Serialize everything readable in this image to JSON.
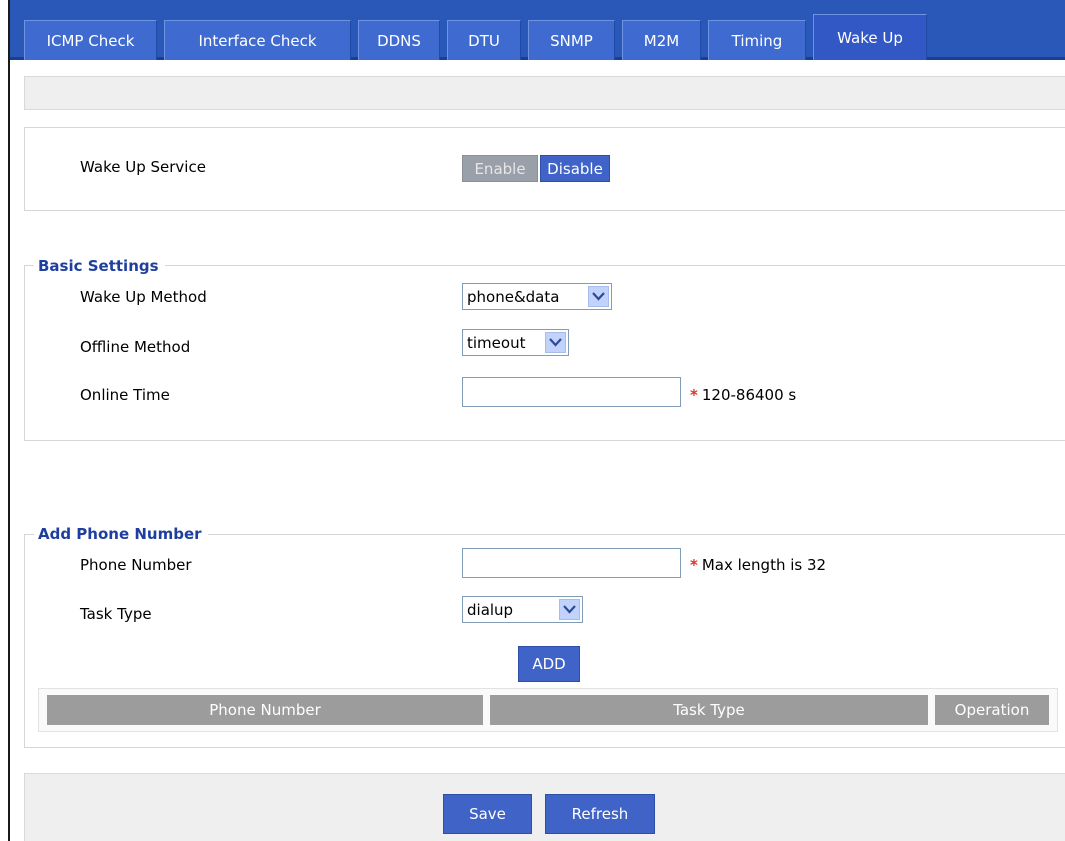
{
  "tabs": [
    {
      "label": "ICMP Check",
      "active": false
    },
    {
      "label": "Interface Check",
      "active": false
    },
    {
      "label": "DDNS",
      "active": false
    },
    {
      "label": "DTU",
      "active": false
    },
    {
      "label": "SNMP",
      "active": false
    },
    {
      "label": "M2M",
      "active": false
    },
    {
      "label": "Timing",
      "active": false
    },
    {
      "label": "Wake Up",
      "active": true
    }
  ],
  "service": {
    "label": "Wake Up Service",
    "enable_label": "Enable",
    "disable_label": "Disable",
    "selected": "Disable"
  },
  "basic": {
    "legend": "Basic Settings",
    "method_label": "Wake Up Method",
    "method_value": "phone&data",
    "offline_label": "Offline Method",
    "offline_value": "timeout",
    "online_label": "Online Time",
    "online_value": "",
    "online_hint": "120-86400 s",
    "required_mark": "*"
  },
  "phone": {
    "legend": "Add Phone Number",
    "number_label": "Phone Number",
    "number_value": "",
    "number_hint": "Max length is 32",
    "required_mark": "*",
    "task_label": "Task Type",
    "task_value": "dialup",
    "add_label": "ADD"
  },
  "table": {
    "columns": [
      "Phone Number",
      "Task Type",
      "Operation"
    ],
    "rows": []
  },
  "footer": {
    "save_label": "Save",
    "refresh_label": "Refresh"
  },
  "colors": {
    "tabbar": "#2a58b8",
    "tab": "#3f6ad0",
    "button": "#3f63c6",
    "required": "#e0302a",
    "legend": "#1f3f9e",
    "table_header": "#9c9c9c"
  },
  "icons": {
    "select_arrow": "chevron-down-icon"
  }
}
